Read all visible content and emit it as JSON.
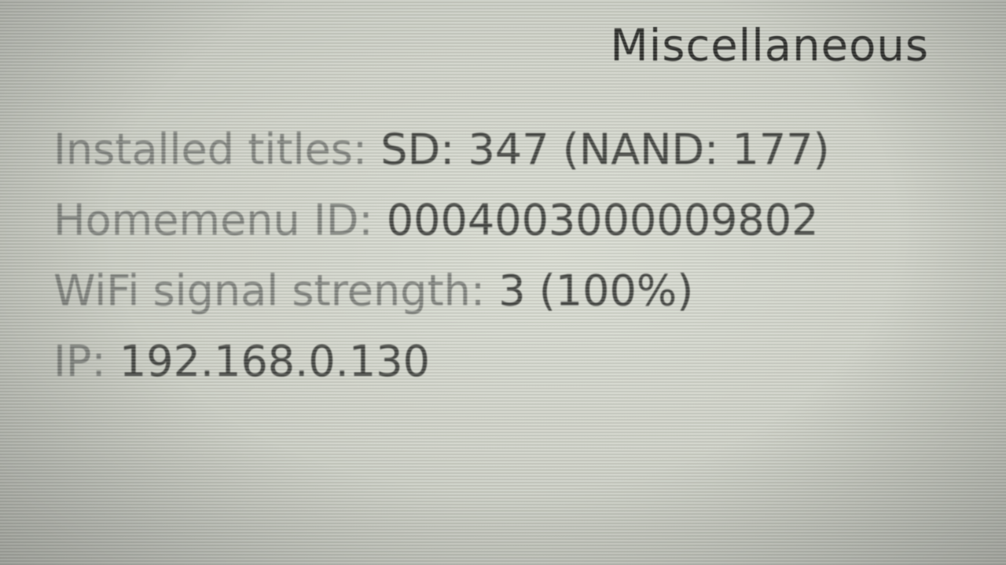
{
  "header": {
    "title": "Miscellaneous"
  },
  "info": {
    "installed_titles": {
      "label": "Installed titles:",
      "value": "SD: 347 (NAND: 177)"
    },
    "homemenu_id": {
      "label": "Homemenu ID:",
      "value": "0004003000009802"
    },
    "wifi_signal": {
      "label": "WiFi signal strength:",
      "value": "3 (100%)"
    },
    "ip": {
      "label": "IP:",
      "value": "192.168.0.130"
    }
  },
  "colors": {
    "background": "#d9dcd2",
    "label_text": "#80837e",
    "value_text": "#464844",
    "title_text": "#2f302d"
  }
}
